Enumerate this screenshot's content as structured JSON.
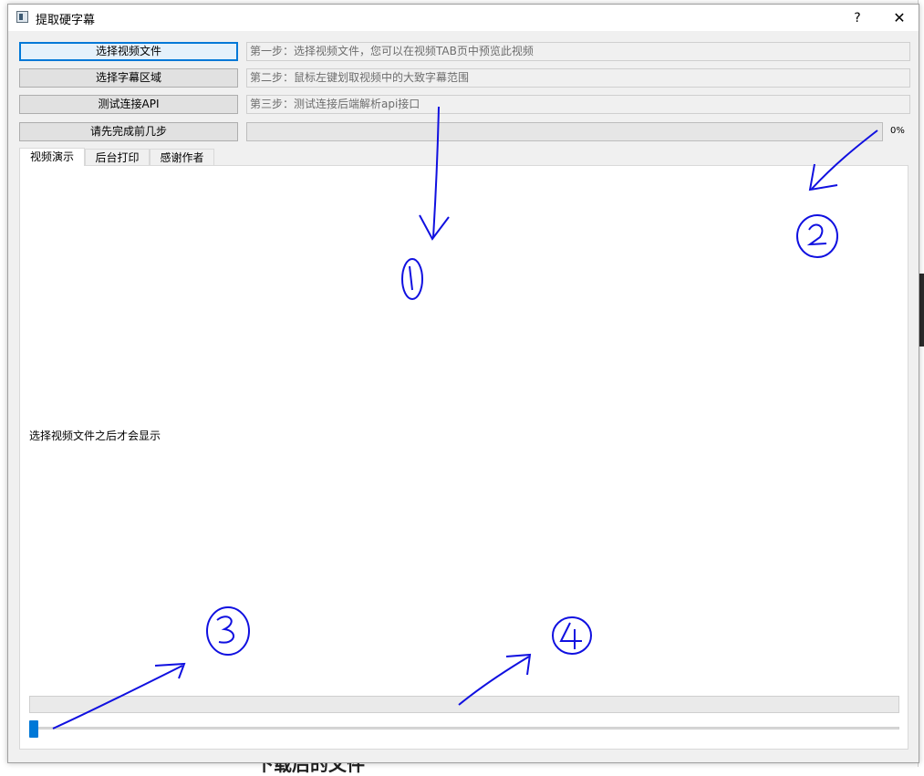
{
  "window": {
    "title": "提取硬字幕",
    "help_label": "?",
    "close_label": "✕"
  },
  "steps": [
    {
      "button": "选择视频文件",
      "hint": "第一步：选择视频文件，您可以在视频TAB页中预览此视频"
    },
    {
      "button": "选择字幕区域",
      "hint": "第二步：鼠标左键划取视频中的大致字幕范围"
    },
    {
      "button": "测试连接API",
      "hint": "第三步：测试连接后端解析api接口"
    }
  ],
  "run": {
    "button": "请先完成前几步",
    "progress_value": 0,
    "progress_label": "0%"
  },
  "tabs": [
    {
      "label": "视频演示",
      "active": true
    },
    {
      "label": "后台打印",
      "active": false
    },
    {
      "label": "感谢作者",
      "active": false
    }
  ],
  "panel": {
    "message": "选择视频文件之后才会显示",
    "slider_value": 0
  },
  "annotations": {
    "color": "#1010e0",
    "labels": [
      "1",
      "2",
      "3",
      "4"
    ]
  },
  "background": {
    "bottom_text": "下载后的文件"
  }
}
